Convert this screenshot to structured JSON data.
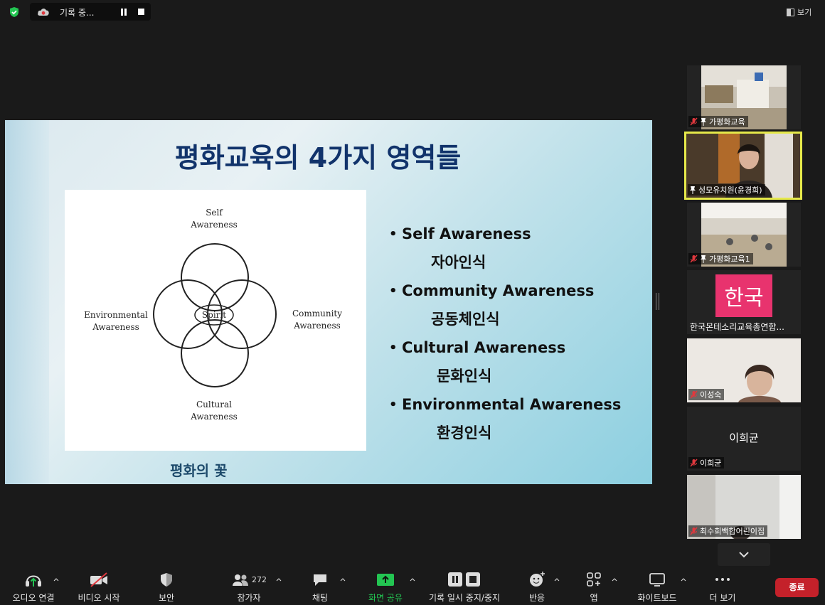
{
  "topbar": {
    "recording_text": "기록 중...",
    "view_label": "보기"
  },
  "slide": {
    "title": "평화교육의 4가지 영역들",
    "diagram": {
      "self": "Self\nAwareness",
      "community": "Community\nAwareness",
      "environmental": "Environmental\nAwareness",
      "cultural": "Cultural\nAwareness",
      "center": "Spirit"
    },
    "caption": "평화의 꽃",
    "bullets": [
      {
        "en": "Self  Awareness",
        "ko": "자아인식"
      },
      {
        "en": "Community Awareness",
        "ko": "공동체인식"
      },
      {
        "en": "Cultural Awareness",
        "ko": "문화인식"
      },
      {
        "en": "Environmental Awareness",
        "ko": "환경인식"
      }
    ]
  },
  "participants": [
    {
      "name": "가평화교육",
      "muted": true,
      "pinned": true
    },
    {
      "name": "성모유치원(윤경희)",
      "muted": false,
      "pinned": true,
      "active": true
    },
    {
      "name": "가평화교육1",
      "muted": true,
      "pinned": true
    },
    {
      "name": "한국몬테소리교육총연합...",
      "avatar_text": "한국",
      "avatar_color": "#e8336e"
    },
    {
      "name": "이성숙",
      "muted": true
    },
    {
      "name": "이희균",
      "muted": true,
      "display_name": "이희균"
    },
    {
      "name": "최수희백합어린이집",
      "muted": true
    }
  ],
  "toolbar": {
    "audio": "오디오 연결",
    "video": "비디오 시작",
    "security": "보안",
    "participants": "참가자",
    "participant_count": "272",
    "chat": "채팅",
    "share": "화면 공유",
    "record": "기록 일시 중지/중지",
    "reactions": "반응",
    "apps": "앱",
    "whiteboard": "화이트보드",
    "more": "더 보기",
    "end": "종료"
  },
  "colors": {
    "share_green": "#23c552",
    "end_red": "#c4212a",
    "active_border": "#e6e94a",
    "muted_red": "#e0383e"
  }
}
